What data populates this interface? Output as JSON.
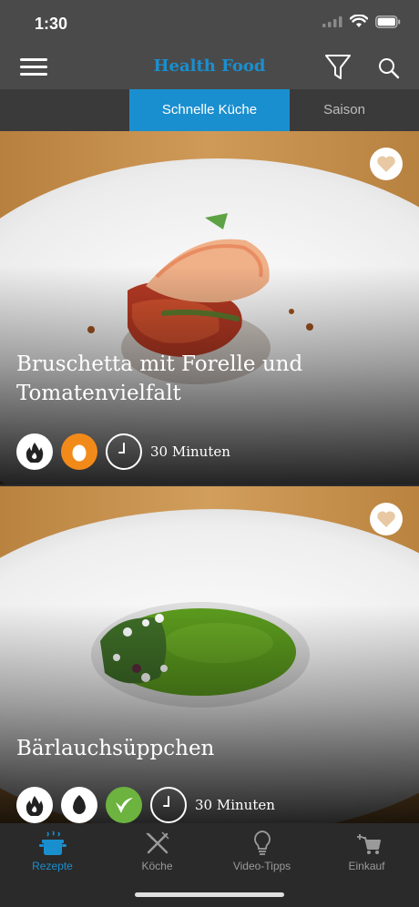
{
  "status_bar": {
    "time": "1:30"
  },
  "nav": {
    "title": "Health Food"
  },
  "tabs": [
    {
      "label": "Schnelle Küche",
      "active": true
    },
    {
      "label": "Saison",
      "active": false
    }
  ],
  "recipes": [
    {
      "title": "Bruschetta mit Forelle und Tomatenvielfalt",
      "tags": [
        "flame-icon",
        "egg-icon"
      ],
      "duration": "30 Minuten"
    },
    {
      "title": "Bärlauchsüppchen",
      "tags": [
        "flame-icon",
        "avocado-icon",
        "vegan-leaf-icon"
      ],
      "duration": "30 Minuten"
    }
  ],
  "tab_bar": [
    {
      "label": "Rezepte",
      "icon": "pot-icon",
      "active": true
    },
    {
      "label": "Köche",
      "icon": "cutlery-icon",
      "active": false
    },
    {
      "label": "Video-Tipps",
      "icon": "lightbulb-icon",
      "active": false
    },
    {
      "label": "Einkauf",
      "icon": "cart-icon",
      "active": false
    }
  ],
  "colors": {
    "accent": "#1a8fcf",
    "orange": "#f28a1a",
    "green": "#6cb33f",
    "bar": "#4a4a4a"
  }
}
